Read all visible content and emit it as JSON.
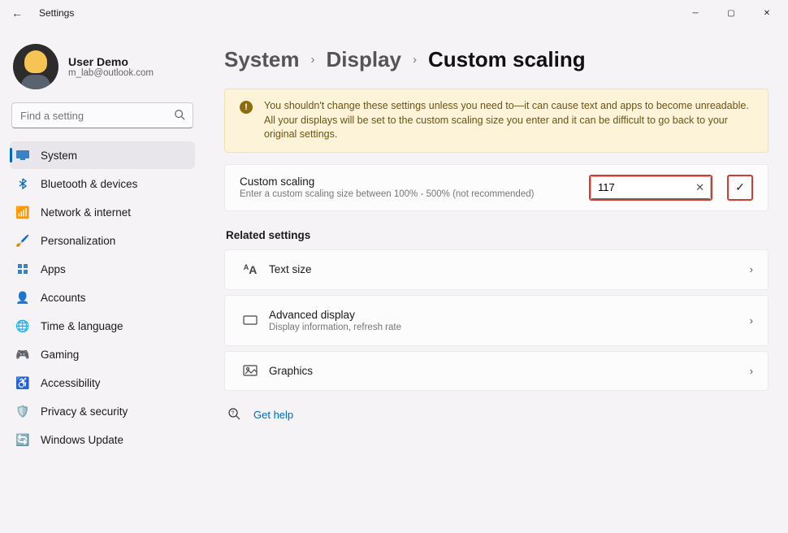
{
  "titlebar": {
    "title": "Settings"
  },
  "profile": {
    "name": "User Demo",
    "email": "m_lab@outlook.com"
  },
  "search": {
    "placeholder": "Find a setting"
  },
  "nav": [
    {
      "label": "System",
      "icon": "🖥️",
      "active": true
    },
    {
      "label": "Bluetooth & devices",
      "icon": "bt"
    },
    {
      "label": "Network & internet",
      "icon": "📶"
    },
    {
      "label": "Personalization",
      "icon": "🖌️"
    },
    {
      "label": "Apps",
      "icon": "▦"
    },
    {
      "label": "Accounts",
      "icon": "👤"
    },
    {
      "label": "Time & language",
      "icon": "🌐"
    },
    {
      "label": "Gaming",
      "icon": "🎮"
    },
    {
      "label": "Accessibility",
      "icon": "♿"
    },
    {
      "label": "Privacy & security",
      "icon": "🛡️"
    },
    {
      "label": "Windows Update",
      "icon": "🔄"
    }
  ],
  "breadcrumb": {
    "a": "System",
    "b": "Display",
    "c": "Custom scaling"
  },
  "warning": "You shouldn't change these settings unless you need to—it can cause text and apps to become unreadable. All your displays will be set to the custom scaling size you enter and it can be difficult to go back to your original settings.",
  "custom": {
    "title": "Custom scaling",
    "sub": "Enter a custom scaling size between 100% - 500% (not recommended)",
    "value": "117"
  },
  "related": {
    "title": "Related settings",
    "items": [
      {
        "icon": "AA",
        "title": "Text size",
        "sub": ""
      },
      {
        "icon": "▭",
        "title": "Advanced display",
        "sub": "Display information, refresh rate"
      },
      {
        "icon": "🖼️",
        "title": "Graphics",
        "sub": ""
      }
    ]
  },
  "help": {
    "label": "Get help"
  }
}
